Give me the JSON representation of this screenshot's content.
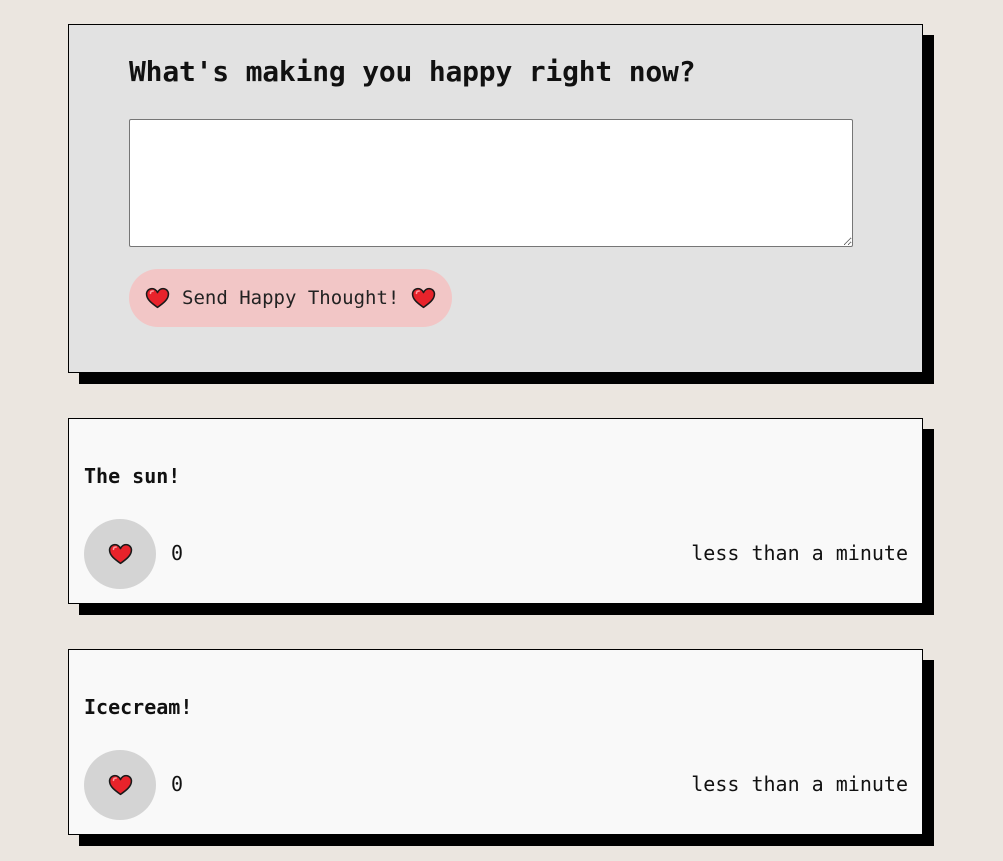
{
  "form": {
    "title": "What's making you happy right now?",
    "input_value": "",
    "input_placeholder": "",
    "send_label": "Send Happy Thought!",
    "button_bg": "#f2c6c6",
    "heart_icon": "heart-icon",
    "heart_color": "#e8232b"
  },
  "thoughts": [
    {
      "text": "The sun!",
      "likes": "0",
      "time": "less than a minute"
    },
    {
      "text": "Icecream!",
      "likes": "0",
      "time": "less than a minute"
    }
  ],
  "colors": {
    "page_bg": "#ebe6e0",
    "form_bg": "#e2e2e2",
    "card_bg": "#f9f9f9",
    "like_bg": "#d4d4d4",
    "shadow": "#000000"
  }
}
